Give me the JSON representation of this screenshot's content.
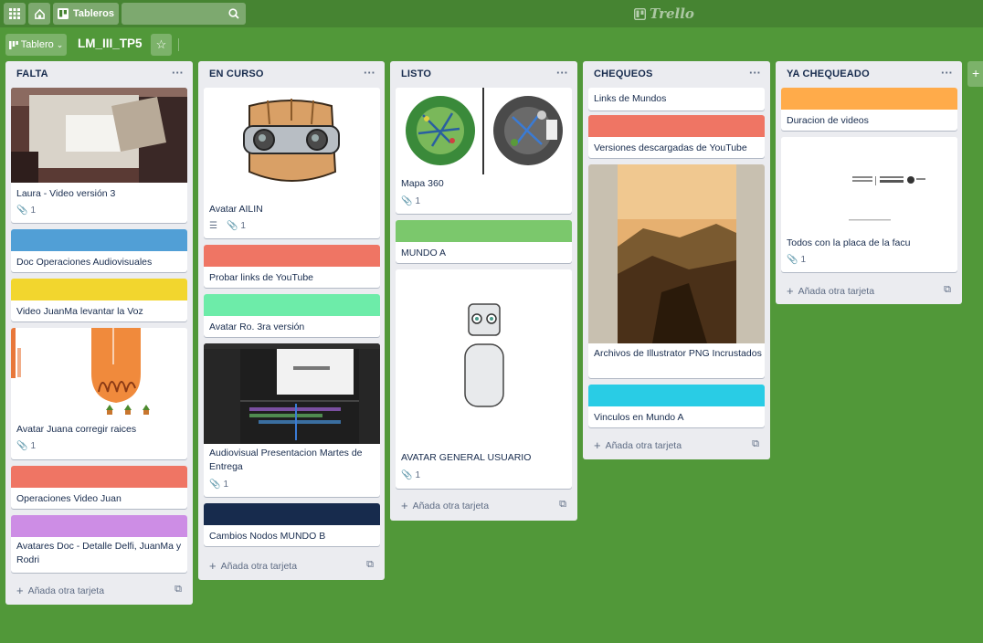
{
  "topbar": {
    "boards_label": "Tableros",
    "logo": "Trello"
  },
  "boardbar": {
    "board_button": "Tablero",
    "title": "LM_III_TP5"
  },
  "add_card_label": "Añada otra tarjeta",
  "lists": [
    {
      "title": "FALTA",
      "cards": [
        {
          "title": "Laura - Video versión 3",
          "attachments": "1"
        },
        {
          "title": "Doc Operaciones Audiovisuales",
          "label_color": "#519fd6"
        },
        {
          "title": "Video JuanMa levantar la Voz",
          "label_color": "#f2d62e"
        },
        {
          "title": "Avatar Juana corregir raices",
          "attachments": "1"
        },
        {
          "title": "Operaciones Video Juan",
          "label_color": "#ef7564"
        },
        {
          "title": "Avatares Doc - Detalle Delfi, JuanMa y Rodri",
          "label_color": "#cd8de5"
        }
      ]
    },
    {
      "title": "EN CURSO",
      "cards": [
        {
          "title": "Avatar AILIN",
          "attachments": "1"
        },
        {
          "title": "Probar links de YouTube",
          "label_color": "#ef7564"
        },
        {
          "title": "Avatar Ro. 3ra versión",
          "label_color": "#6deca9"
        },
        {
          "title": "Audiovisual Presentacion Martes de Entrega",
          "attachments": "1"
        },
        {
          "title": "Cambios Nodos MUNDO B",
          "label_color": "#172b4d"
        }
      ]
    },
    {
      "title": "LISTO",
      "cards": [
        {
          "title": "Mapa 360",
          "attachments": "1"
        },
        {
          "title": "MUNDO A",
          "label_color": "#7bc86c"
        },
        {
          "title": "AVATAR GENERAL USUARIO",
          "attachments": "1"
        }
      ]
    },
    {
      "title": "CHEQUEOS",
      "cards": [
        {
          "title": "Links de Mundos"
        },
        {
          "title": "Versiones descargadas de YouTube",
          "label_color": "#ef7564"
        },
        {
          "title": "Archivos de Illustrator PNG Incrustados"
        },
        {
          "title": "Vinculos en Mundo A",
          "label_color": "#29cce5"
        }
      ]
    },
    {
      "title": "YA CHEQUEADO",
      "cards": [
        {
          "title": "Duracion de videos",
          "label_color": "#ffab4a"
        },
        {
          "title": "Todos con la placa de la facu",
          "attachments": "1"
        }
      ]
    }
  ]
}
